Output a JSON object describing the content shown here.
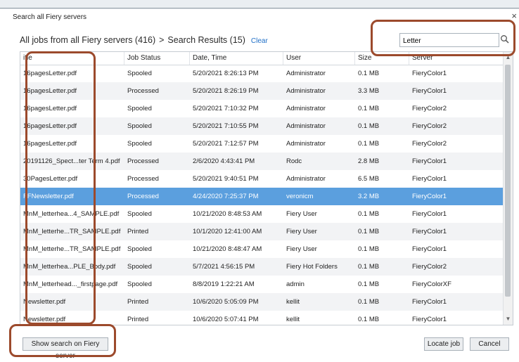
{
  "dialog": {
    "title": "Search all Fiery servers",
    "close_glyph": "×"
  },
  "breadcrumb": {
    "root": "All jobs from all Fiery servers (416)",
    "separator": ">",
    "current": "Search Results (15)",
    "clear_label": "Clear"
  },
  "search": {
    "value": "Letter",
    "icon": "search-icon"
  },
  "table": {
    "columns": [
      "itle",
      "Job Status",
      "Date, Time",
      "User",
      "Size",
      "Server"
    ],
    "selected_row_index": 7,
    "rows": [
      {
        "title": "16pagesLetter.pdf",
        "status": "Spooled",
        "datetime": "5/20/2021 8:26:13 PM",
        "user": "Administrator",
        "size": "0.1 MB",
        "server": "FieryColor1"
      },
      {
        "title": "16pagesLetter.pdf",
        "status": "Processed",
        "datetime": "5/20/2021 8:26:19 PM",
        "user": "Administrator",
        "size": "3.3 MB",
        "server": "FieryColor1"
      },
      {
        "title": "16pagesLetter.pdf",
        "status": "Spooled",
        "datetime": "5/20/2021 7:10:32 PM",
        "user": "Administrator",
        "size": "0.1 MB",
        "server": "FieryColor2"
      },
      {
        "title": "16pagesLetter.pdf",
        "status": "Spooled",
        "datetime": "5/20/2021 7:10:55 PM",
        "user": "Administrator",
        "size": "0.1 MB",
        "server": "FieryColor2"
      },
      {
        "title": "16pagesLetter.pdf",
        "status": "Spooled",
        "datetime": "5/20/2021 7:12:57 PM",
        "user": "Administrator",
        "size": "0.1 MB",
        "server": "FieryColor2"
      },
      {
        "title": "20191126_Spect...ter Term 4.pdf",
        "status": "Processed",
        "datetime": "2/6/2020 4:43:41 PM",
        "user": "Rodc",
        "size": "2.8 MB",
        "server": "FieryColor1"
      },
      {
        "title": "30PagesLetter.pdf",
        "status": "Processed",
        "datetime": "5/20/2021 9:40:51 PM",
        "user": "Administrator",
        "size": "6.5 MB",
        "server": "FieryColor1"
      },
      {
        "title": "FFNewsletter.pdf",
        "status": "Processed",
        "datetime": "4/24/2020 7:25:37 PM",
        "user": "veronicm",
        "size": "3.2 MB",
        "server": "FieryColor1"
      },
      {
        "title": "MnM_letterhea...4_SAMPLE.pdf",
        "status": "Spooled",
        "datetime": "10/21/2020 8:48:53 AM",
        "user": "Fiery User",
        "size": "0.1 MB",
        "server": "FieryColor1"
      },
      {
        "title": "MnM_letterhe...TR_SAMPLE.pdf",
        "status": "Printed",
        "datetime": "10/1/2020 12:41:00 AM",
        "user": "Fiery User",
        "size": "0.1 MB",
        "server": "FieryColor1"
      },
      {
        "title": "MnM_letterhe...TR_SAMPLE.pdf",
        "status": "Spooled",
        "datetime": "10/21/2020 8:48:47 AM",
        "user": "Fiery User",
        "size": "0.1 MB",
        "server": "FieryColor1"
      },
      {
        "title": "MnM_letterhea...PLE_Body.pdf",
        "status": "Spooled",
        "datetime": "5/7/2021 4:56:15 PM",
        "user": "Fiery Hot Folders",
        "size": "0.1 MB",
        "server": "FieryColor2"
      },
      {
        "title": "MnM_letterhead..._firstpage.pdf",
        "status": "Spooled",
        "datetime": "8/8/2019 1:22:21 AM",
        "user": "admin",
        "size": "0.1 MB",
        "server": "FieryColorXF"
      },
      {
        "title": "Newsletter.pdf",
        "status": "Printed",
        "datetime": "10/6/2020 5:05:09 PM",
        "user": "kellit",
        "size": "0.1 MB",
        "server": "FieryColor1"
      },
      {
        "title": "Newsletter.pdf",
        "status": "Printed",
        "datetime": "10/6/2020 5:07:41 PM",
        "user": "kellit",
        "size": "0.1 MB",
        "server": "FieryColor1"
      }
    ]
  },
  "buttons": {
    "show_search": "Show search on Fiery server",
    "locate_job": "Locate job",
    "cancel": "Cancel"
  },
  "colors": {
    "selection": "#5b9fde",
    "highlight_outline": "#9c4a2c",
    "link": "#1f6fc7"
  }
}
